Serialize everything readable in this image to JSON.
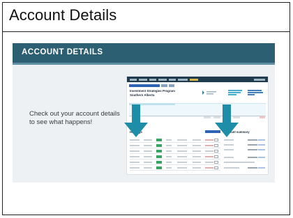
{
  "cell": {
    "title": "Account Details"
  },
  "slide": {
    "banner_title": "ACCOUNT DETAILS",
    "body_text": "Check out your account details to see what happens!"
  },
  "screenshot": {
    "program_title": "Investment Strategies Program",
    "program_subtitle": "Southern Alberta",
    "holdings_label": "Holdings",
    "account_summary_label": "Account summary"
  },
  "colors": {
    "banner": "#2d5f73",
    "arrow": "#1e8ea8",
    "slide_bg": "#eef1f4"
  },
  "icons": {
    "arrow_left": "down-arrow-icon",
    "arrow_right": "down-arrow-icon"
  }
}
